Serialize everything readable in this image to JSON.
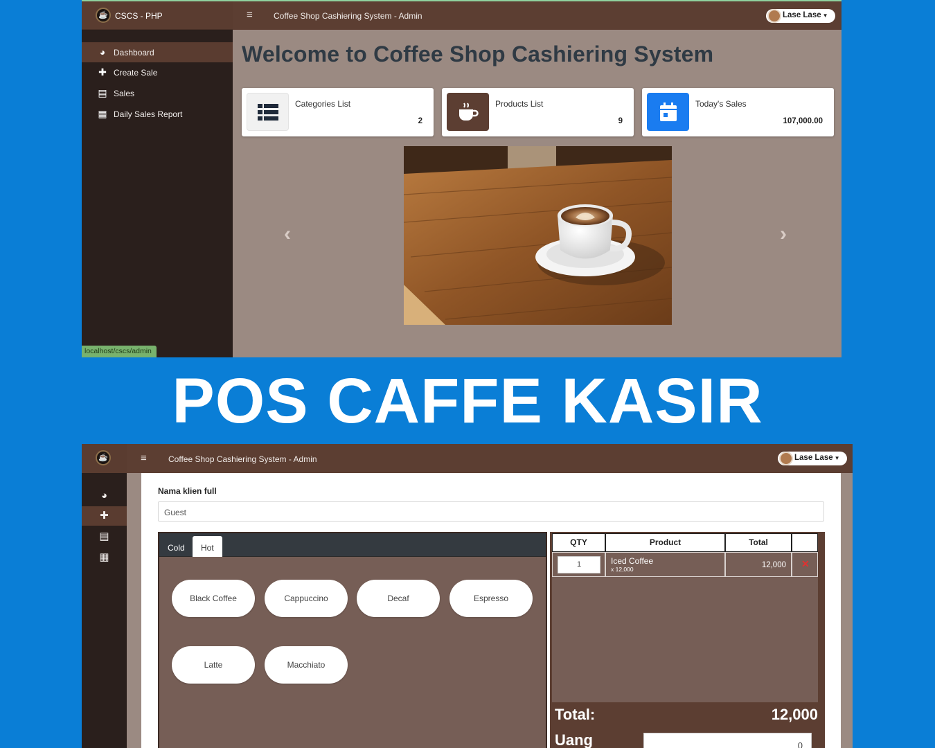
{
  "colors": {
    "background": "#0a7ed6",
    "brown_header": "#5c3e32",
    "sidebar": "#2a1f1c",
    "content": "#9b8a82",
    "accent_blue": "#1a7cf0"
  },
  "top_screen": {
    "brand": "CSCS - PHP",
    "header_title": "Coffee Shop Cashiering System - Admin",
    "user": "Lase Lase",
    "nav": [
      {
        "label": "Dashboard",
        "icon": "tachometer-icon",
        "glyph": "◕",
        "active": true
      },
      {
        "label": "Create Sale",
        "icon": "plus-icon",
        "glyph": "✚",
        "active": false
      },
      {
        "label": "Sales",
        "icon": "file-icon",
        "glyph": "▤",
        "active": false
      },
      {
        "label": "Daily Sales Report",
        "icon": "calendar-icon",
        "glyph": "▦",
        "active": false
      }
    ],
    "welcome": "Welcome to Coffee Shop Cashiering System",
    "cards": [
      {
        "label": "Categories List",
        "value": "2",
        "icon": "list-icon",
        "color": "#f1f1f1"
      },
      {
        "label": "Products List",
        "value": "9",
        "icon": "coffee-icon",
        "color": "#5c3e32"
      },
      {
        "label": "Today's Sales",
        "value": "107,000.00",
        "icon": "calendar-icon",
        "color": "#1a7cf0"
      }
    ],
    "status_url": "localhost/cscs/admin"
  },
  "banner": "POS CAFFE KASIR",
  "bottom_screen": {
    "header_title": "Coffee Shop Cashiering System - Admin",
    "user": "Lase Lase",
    "client_label": "Nama klien full",
    "client_value": "Guest",
    "tabs": [
      "Cold",
      "Hot"
    ],
    "active_tab": "Hot",
    "products": [
      "Black Coffee",
      "Cappuccino",
      "Decaf",
      "Espresso",
      "Latte",
      "Macchiato"
    ],
    "table_headers": [
      "QTY",
      "Product",
      "Total"
    ],
    "order_items": [
      {
        "qty": "1",
        "product": "Iced Coffee",
        "price_note": "x 12,000",
        "total": "12,000"
      }
    ],
    "total_label": "Total:",
    "total_value": "12,000",
    "uang_label": "Uang",
    "uang_value": "0"
  }
}
